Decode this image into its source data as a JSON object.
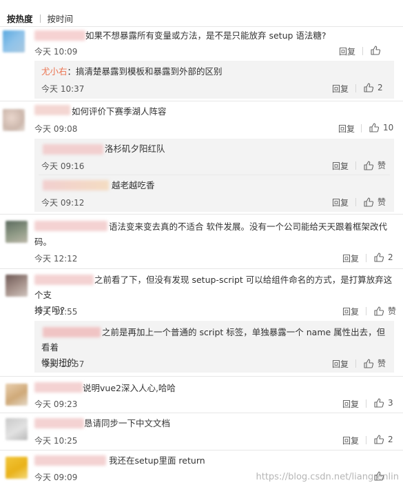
{
  "tabs": [
    "按热度",
    "按时间"
  ],
  "labels": {
    "reply": "回复",
    "like_word": "赞"
  },
  "colors": {
    "username": "#eb7350",
    "sub_bg": "#f3f3f3",
    "divider": "#e6e6e6"
  },
  "icons": {
    "like": "thumbs-up-icon"
  },
  "comments": [
    {
      "text": "如果不想暴露所有变量或方法，是不是只能放弃 setup 语法糖?",
      "time": "今天 10:09",
      "likes": "",
      "replies": [
        {
          "username": "尤小右",
          "text": "：搞清楚暴露到模板和暴露到外部的区别",
          "time": "今天 10:37",
          "likes": "2"
        }
      ]
    },
    {
      "text": "如何评价下赛季湖人阵容",
      "time": "今天 09:08",
      "likes": "10",
      "replies": [
        {
          "text": "洛杉矶夕阳红队",
          "time": "今天 09:16",
          "likes": "赞"
        },
        {
          "text": "越老越吃香",
          "time": "今天 09:12",
          "likes": "赞"
        }
      ]
    },
    {
      "text_line1": "语法变来变去真的不适合 软件发展。没有一个公司能给天天跟着框架改代",
      "text_line2": "码。",
      "time": "今天 12:12",
      "likes": "2"
    },
    {
      "text_line1": "之前看了下，但没有发现 setup-script 可以给组件命名的方式，是打算放弃这个支",
      "text_line2": "持了吗?",
      "time": "今天 11:55",
      "likes": "赞",
      "replies": [
        {
          "text_line1": "之前是再加上一个普通的 script 标签，单独暴露一个 name 属性出去，但看着",
          "text_line2": "怪别扭的",
          "time": "今天 11:57",
          "likes": "赞"
        }
      ]
    },
    {
      "text": "说明vue2深入人心,哈哈",
      "time": "今天 09:23",
      "likes": "3"
    },
    {
      "text": "恳请同步一下中文文档",
      "time": "今天 10:25",
      "likes": "2"
    },
    {
      "text": "我还在setup里面 return",
      "time": "今天 09:09",
      "likes": ""
    }
  ],
  "watermark": "https://blog.csdn.net/liangrenlin"
}
